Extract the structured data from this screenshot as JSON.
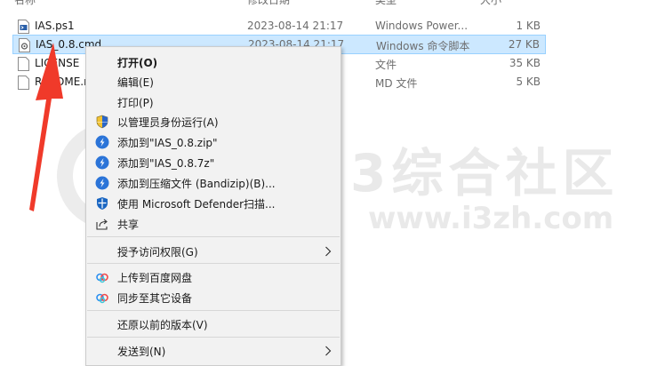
{
  "columns": {
    "name": "名称",
    "date": "修改日期",
    "type": "类型",
    "size": "大小"
  },
  "files": [
    {
      "name": "IAS.ps1",
      "date": "2023-08-14 21:17",
      "type": "Windows Power...",
      "size": "1 KB",
      "icon": "powershell-file-icon",
      "selected": false
    },
    {
      "name": "IAS_0.8.cmd",
      "date": "2023-08-14 21:17",
      "type": "Windows 命令脚本",
      "size": "27 KB",
      "icon": "cmd-file-icon",
      "selected": true
    },
    {
      "name": "LICENSE",
      "date": "",
      "type": "文件",
      "size": "35 KB",
      "icon": "blank-file-icon",
      "selected": false
    },
    {
      "name": "README.md",
      "date": "",
      "type": "MD 文件",
      "size": "5 KB",
      "icon": "blank-file-icon",
      "selected": false
    }
  ],
  "menu": {
    "open": "打开(O)",
    "edit": "编辑(E)",
    "print": "打印(P)",
    "run_as_admin": "以管理员身份运行(A)",
    "add_zip": "添加到\"IAS_0.8.zip\"",
    "add_7z": "添加到\"IAS_0.8.7z\"",
    "add_compressed": "添加到压缩文件 (Bandizip)(B)...",
    "defender": "使用 Microsoft Defender扫描...",
    "share": "共享",
    "grant_access": "授予访问权限(G)",
    "upload_baidu": "上传到百度网盘",
    "sync_devices": "同步至其它设备",
    "restore_versions": "还原以前的版本(V)",
    "send_to": "发送到(N)"
  },
  "watermark": {
    "title": "3综合社区",
    "url": "www.i3zh.com"
  },
  "colors": {
    "selection": "#cce8ff",
    "arrow": "#f03a2a",
    "menu_bg": "#f2f2f2",
    "bandizip_blue": "#2b74d8"
  }
}
